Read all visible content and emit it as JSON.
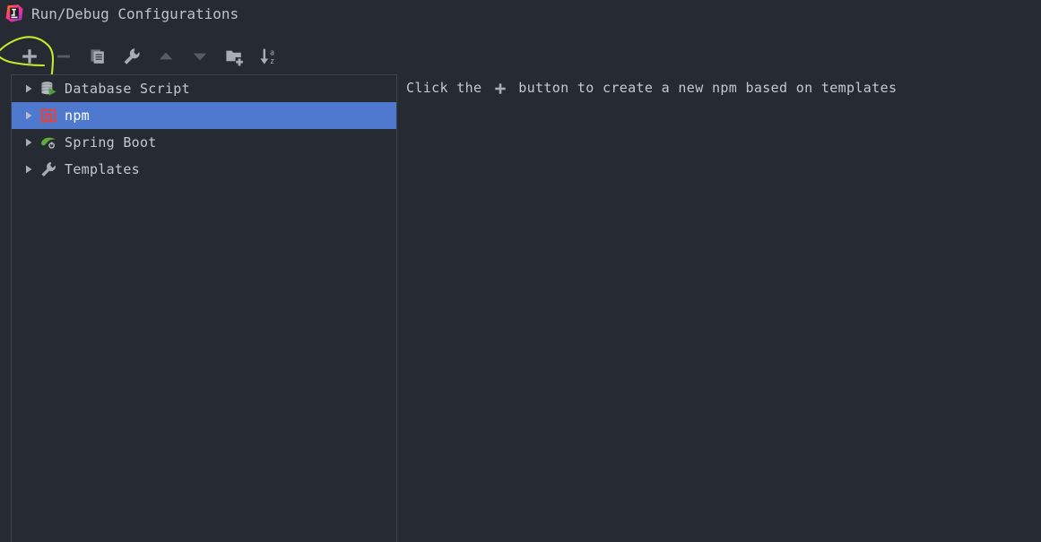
{
  "window": {
    "title": "Run/Debug Configurations",
    "logo_icon": "intellij-idea-logo"
  },
  "toolbar": {
    "buttons": [
      {
        "name": "add",
        "icon": "plus-icon",
        "label": "Add New Configuration",
        "enabled": true,
        "annotated": true
      },
      {
        "name": "remove",
        "icon": "minus-icon",
        "label": "Remove Configuration",
        "enabled": false,
        "annotated": false
      },
      {
        "name": "copy",
        "icon": "copy-icon",
        "label": "Copy Configuration",
        "enabled": false,
        "annotated": false
      },
      {
        "name": "edit-templates",
        "icon": "wrench-icon",
        "label": "Edit Templates",
        "enabled": true,
        "annotated": false
      },
      {
        "name": "move-up",
        "icon": "arrow-up-icon",
        "label": "Move Up",
        "enabled": false,
        "annotated": false
      },
      {
        "name": "move-down",
        "icon": "arrow-down-icon",
        "label": "Move Down",
        "enabled": false,
        "annotated": false
      },
      {
        "name": "new-folder",
        "icon": "folder-add-icon",
        "label": "Create New Folder",
        "enabled": true,
        "annotated": false
      },
      {
        "name": "sort",
        "icon": "sort-alphabetical-icon",
        "label": "Sort Configurations",
        "enabled": true,
        "annotated": false
      }
    ]
  },
  "configuration_tree": {
    "items": [
      {
        "label": "Database Script",
        "icon": "database-script-icon",
        "expander": "chevron-right-icon",
        "selected": false
      },
      {
        "label": "npm",
        "icon": "npm-icon",
        "expander": "chevron-right-icon",
        "selected": true
      },
      {
        "label": "Spring Boot",
        "icon": "spring-boot-icon",
        "expander": "chevron-right-icon",
        "selected": false
      },
      {
        "label": "Templates",
        "icon": "wrench-icon",
        "expander": "chevron-right-icon",
        "selected": false
      }
    ]
  },
  "detail": {
    "hint_before": "Click the ",
    "hint_icon": "plus-icon",
    "hint_after": " button to create a new npm based on templates"
  },
  "annotation": {
    "type": "hand-drawn-highlight",
    "target": "add-configuration-button",
    "color": "#c9e82a"
  },
  "colors": {
    "background": "#262b33",
    "panel_border": "#3c424c",
    "selection": "#4e79cf",
    "text": "#c3c9d1",
    "icon_gray": "#a7adb5",
    "icon_disabled": "#565c66",
    "npm_red": "#e0453e",
    "spring_green": "#6aab3c",
    "annotation": "#c9e82a"
  }
}
